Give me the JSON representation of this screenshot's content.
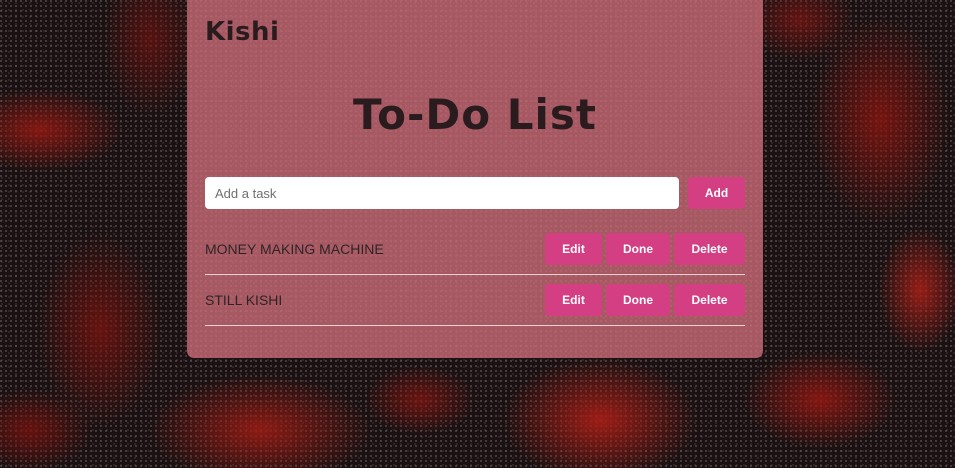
{
  "app": {
    "brand": "Kishi",
    "title": "To-Do List"
  },
  "input": {
    "placeholder": "Add a task",
    "value": ""
  },
  "add_button": "Add",
  "tasks": [
    {
      "text": "MONEY MAKING MACHINE",
      "edit_label": "Edit",
      "done_label": "Done",
      "delete_label": "Delete"
    },
    {
      "text": "STILL KISHI",
      "edit_label": "Edit",
      "done_label": "Done",
      "delete_label": "Delete"
    }
  ],
  "colors": {
    "card": "#cd6e78",
    "button": "#d33f82",
    "text": "#2a1c1e"
  }
}
